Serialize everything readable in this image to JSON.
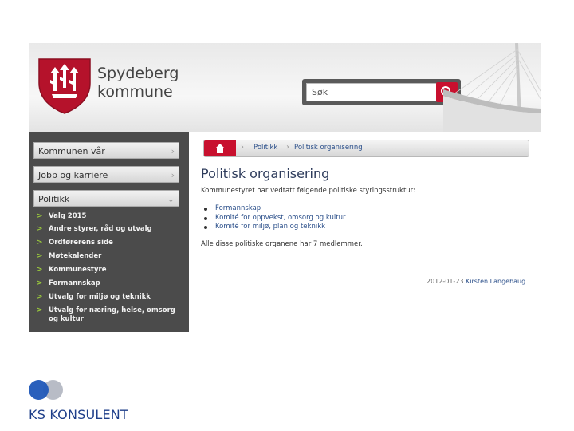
{
  "brand": {
    "line1": "Spydeberg",
    "line2": "kommune"
  },
  "search": {
    "placeholder": "Søk"
  },
  "sidebar": {
    "items": [
      {
        "label": "Kommunen vår"
      },
      {
        "label": "Jobb og karriere"
      },
      {
        "label": "Politikk"
      }
    ],
    "subitems": [
      {
        "label": "Valg 2015",
        "bold": true
      },
      {
        "label": "Andre styrer, råd og utvalg",
        "bold": true
      },
      {
        "label": "Ordførerens side",
        "bold": true
      },
      {
        "label": "Møtekalender",
        "bold": true
      },
      {
        "label": "Kommunestyre",
        "bold": true
      },
      {
        "label": "Formannskap",
        "bold": true
      },
      {
        "label": "Utvalg for miljø og teknikk",
        "bold": true
      },
      {
        "label": "Utvalg for næring, helse, omsorg og kultur",
        "bold": true
      }
    ]
  },
  "breadcrumb": {
    "items": [
      "Politikk",
      "Politisk organisering"
    ]
  },
  "content": {
    "title": "Politisk organisering",
    "intro": "Kommunestyret har vedtatt følgende politiske styringsstruktur:",
    "bullets": [
      "Formannskap",
      "Komité for oppvekst, omsorg og kultur",
      "Komité for miljø, plan og teknikk"
    ],
    "note": "Alle disse politiske organene har 7 medlemmer.",
    "date": "2012-01-23",
    "author": "Kirsten Langehaug"
  },
  "footer_logo": {
    "text": "KS KONSULENT"
  },
  "colors": {
    "accent_red": "#c8102e",
    "sidebar_bg": "#4b4b4b",
    "link_blue": "#2b4f8a",
    "logo_blue": "#1f3f8a",
    "arrow_green": "#9ccc3c"
  }
}
